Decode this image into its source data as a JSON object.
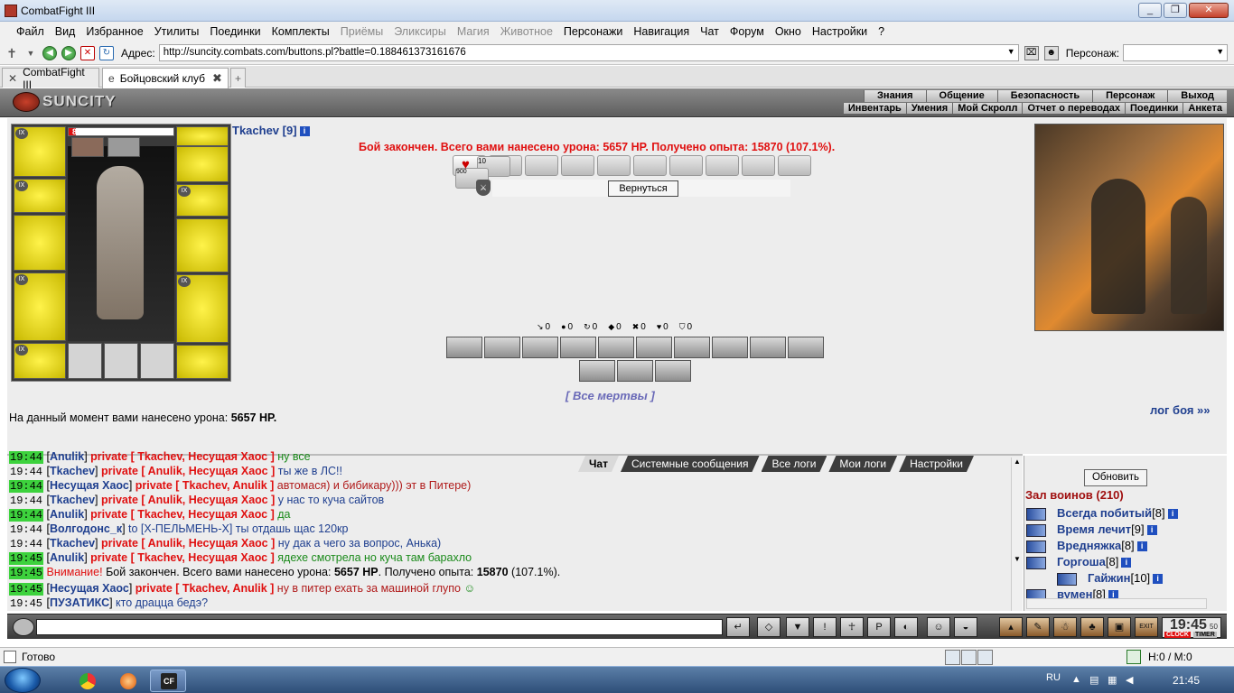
{
  "window": {
    "title": "CombatFight III",
    "buttons": [
      "_",
      "❐",
      "✕"
    ]
  },
  "menu": [
    {
      "label": "Файл",
      "dim": false
    },
    {
      "label": "Вид",
      "dim": false
    },
    {
      "label": "Избранное",
      "dim": false
    },
    {
      "label": "Утилиты",
      "dim": false
    },
    {
      "label": "Поединки",
      "dim": false
    },
    {
      "label": "Комплекты",
      "dim": false
    },
    {
      "label": "Приёмы",
      "dim": true
    },
    {
      "label": "Эликсиры",
      "dim": true
    },
    {
      "label": "Магия",
      "dim": true
    },
    {
      "label": "Животное",
      "dim": true
    },
    {
      "label": "Персонажи",
      "dim": false
    },
    {
      "label": "Навигация",
      "dim": false
    },
    {
      "label": "Чат",
      "dim": false
    },
    {
      "label": "Форум",
      "dim": false
    },
    {
      "label": "Окно",
      "dim": false
    },
    {
      "label": "Настройки",
      "dim": false
    },
    {
      "label": "?",
      "dim": false
    }
  ],
  "address": {
    "label": "Адрес:",
    "url": "http://suncity.combats.com/buttons.pl?battle=0.188461373161676",
    "person_label": "Персонаж:",
    "person_value": ""
  },
  "tabs": [
    {
      "label": "CombatFight III"
    },
    {
      "label": "Бойцовский клуб"
    }
  ],
  "game": {
    "logo": "SUNCITY",
    "nav_top": [
      "Знания",
      "Общение",
      "Безопасность",
      "Персонаж",
      "Выход"
    ],
    "nav_sub": [
      "Инвентарь",
      "Умения",
      "Мой Скролл",
      "Отчет о переводах",
      "Поединки",
      "Анкета"
    ]
  },
  "player": {
    "name": "Tkachev [9]",
    "hp": "89/1255",
    "hp_current": 89,
    "hp_max": 1255,
    "item_level": "IX",
    "scroll_count": "10",
    "scroll_sub": "900"
  },
  "battle": {
    "result": "Бой закончен. Всего вами нанесено урона: 5657 HP. Получено опыта: 15870 (107.1%).",
    "back_button": "Вернуться",
    "stats": [
      {
        "icon": "↘",
        "value": "0",
        "name": "strike"
      },
      {
        "icon": "●",
        "value": "0",
        "name": "blood"
      },
      {
        "icon": "↻",
        "value": "0",
        "name": "counter"
      },
      {
        "icon": "◆",
        "value": "0",
        "name": "block"
      },
      {
        "icon": "✖",
        "value": "0",
        "name": "crit"
      },
      {
        "icon": "♥",
        "value": "0",
        "name": "heart"
      },
      {
        "icon": "⛉",
        "value": "0",
        "name": "shield"
      }
    ],
    "all_dead": "[ Все мертвы ]",
    "damage_prefix": "На данный момент вами нанесено урона:",
    "damage_value": "5657 HP.",
    "log_link": "лог боя »»"
  },
  "chat": {
    "tabs": [
      "Чат",
      "Системные сообщения",
      "Все логи",
      "Мои логи",
      "Настройки"
    ],
    "lines": [
      {
        "time": "19:44",
        "green": true,
        "nick": "Anulik",
        "priv": "private [ Tkachev, Несущая Хаос ]",
        "msg": "ну все",
        "cls": "gmsg",
        "partial": true
      },
      {
        "time": "19:44",
        "green": false,
        "nick": "Tkachev",
        "priv": "private [ Anulik, Несущая Хаос ]",
        "msg": "ты же в ЛС!!",
        "cls": "tmsg"
      },
      {
        "time": "19:44",
        "green": true,
        "nick": "Несущая Хаос",
        "priv": "private [ Tkachev, Anulik ]",
        "msg": "автомася) и бибикару))) эт в Питере)",
        "cls": "rmsg"
      },
      {
        "time": "19:44",
        "green": false,
        "nick": "Tkachev",
        "priv": "private [ Anulik, Несущая Хаос ]",
        "msg": "у нас то куча сайтов",
        "cls": "tmsg"
      },
      {
        "time": "19:44",
        "green": true,
        "nick": "Anulik",
        "priv": "private [ Tkachev, Несущая Хаос ]",
        "msg": "да",
        "cls": "gmsg"
      },
      {
        "time": "19:44",
        "green": false,
        "nick": "Волгодонс_к",
        "priv": "",
        "to": "to [X-ПЕЛЬМЕНЬ-X]",
        "msg": "ты отдашь щас 120кр",
        "cls": "tmsg"
      },
      {
        "time": "19:44",
        "green": false,
        "nick": "Tkachev",
        "priv": "private [ Anulik, Несущая Хаос ]",
        "msg": "ну дак а чего за вопрос, Анька)",
        "cls": "tmsg"
      },
      {
        "time": "19:45",
        "green": true,
        "nick": "Anulik",
        "priv": "private [ Tkachev, Несущая Хаос ]",
        "msg": "ядехе смотрела но куча там барахло",
        "cls": "gmsg"
      },
      {
        "time": "19:45",
        "green": true,
        "warning": "Внимание!",
        "sys": "Бой закончен. Всего вами нанесено урона:",
        "sys_dmg": "5657 HP",
        "sys2": ". Получено опыта:",
        "sys_exp": "15870",
        "sys3": "(107.1%)."
      },
      {
        "time": "19:45",
        "green": true,
        "nick": "Несущая Хаос",
        "priv": "private [ Tkachev, Anulik ]",
        "msg": "ну в питер ехать за машиной глупо",
        "cls": "rmsg"
      },
      {
        "time": "19:45",
        "green": false,
        "nick": "ПУЗАТИКС",
        "priv": "",
        "msg": "кто драцца бедэ?",
        "cls": "tmsg"
      }
    ]
  },
  "warriors": {
    "refresh": "Обновить",
    "title": "Зал воинов (210)",
    "list": [
      {
        "name": "Всегда побитый",
        "level": "[8]"
      },
      {
        "name": "Время лечит",
        "level": "[9]"
      },
      {
        "name": "Вредняжка",
        "level": "[8]"
      },
      {
        "name": "Горгоша",
        "level": "[8]"
      },
      {
        "name": "Гайжин",
        "level": "[10]"
      },
      {
        "name": "вумен",
        "level": "[8]"
      }
    ]
  },
  "toolbar": {
    "clock": "19:45",
    "seconds": "50",
    "clock_label": "CLOCK",
    "timer_label": "TIMER",
    "exit_label": "EXIT"
  },
  "status": {
    "text": "Готово",
    "hm": "H:0 / M:0"
  },
  "taskbar": {
    "lang": "RU",
    "time": "21:45"
  }
}
